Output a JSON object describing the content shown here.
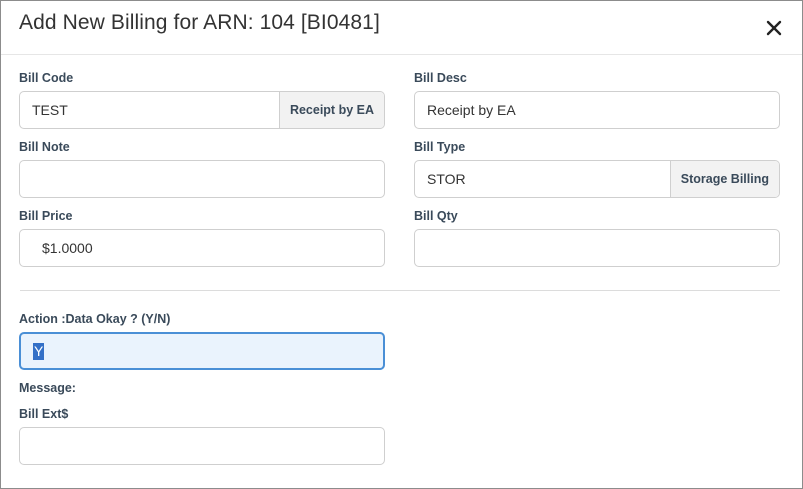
{
  "dialog": {
    "title": "Add New Billing for ARN: 104 [BI0481]",
    "close_icon": "close-icon"
  },
  "fields": {
    "bill_code": {
      "label": "Bill Code",
      "value": "TEST",
      "addon": "Receipt by EA"
    },
    "bill_desc": {
      "label": "Bill Desc",
      "value": "Receipt by EA"
    },
    "bill_note": {
      "label": "Bill Note",
      "value": ""
    },
    "bill_type": {
      "label": "Bill Type",
      "value": "STOR",
      "addon": "Storage Billing"
    },
    "bill_price": {
      "label": "Bill Price",
      "value": "$1.0000"
    },
    "bill_qty": {
      "label": "Bill Qty",
      "value": ""
    },
    "action": {
      "label": "Action :Data Okay ? (Y/N)",
      "value": "Y"
    },
    "message": {
      "label": "Message:"
    },
    "bill_ext": {
      "label": "Bill Ext$",
      "value": ""
    }
  },
  "colors": {
    "focus_border": "#4a8fd6",
    "focus_background": "#eaf3fd",
    "selection": "#3470c7"
  }
}
